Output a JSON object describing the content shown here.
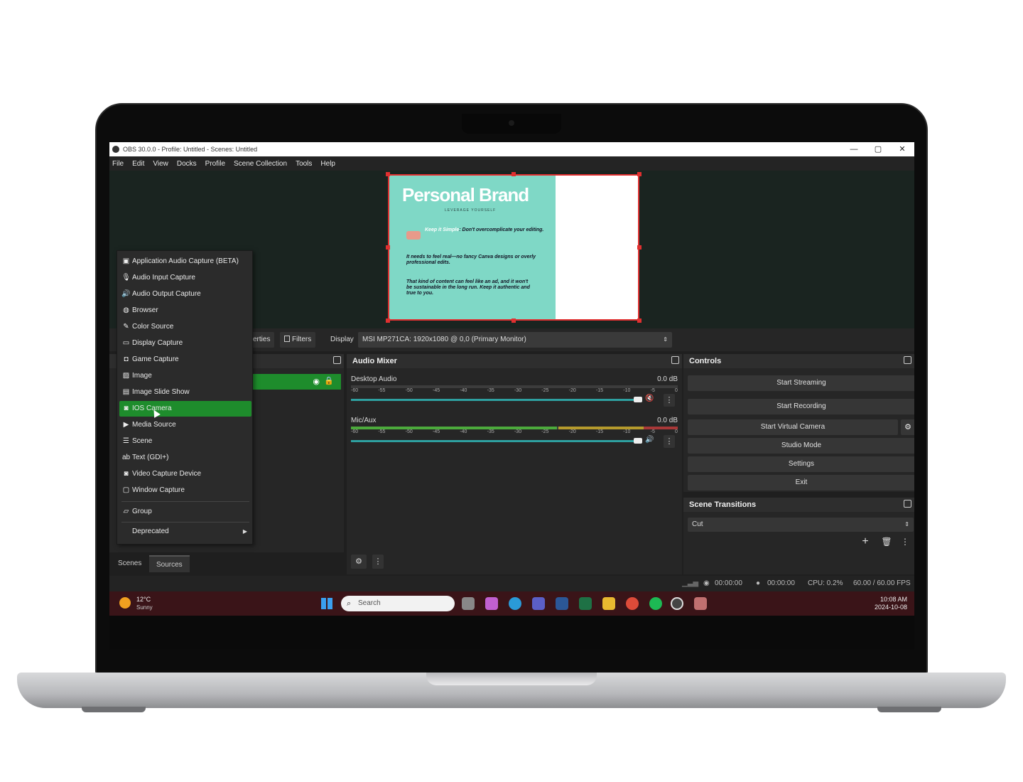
{
  "window": {
    "title": "OBS 30.0.0 - Profile: Untitled - Scenes: Untitled",
    "controls": [
      "—",
      "▢",
      "✕"
    ]
  },
  "menubar": [
    "File",
    "Edit",
    "View",
    "Docks",
    "Profile",
    "Scene Collection",
    "Tools",
    "Help"
  ],
  "preview": {
    "slide_title": "Personal Brand",
    "slide_subtitle": "LEVERAGE YOURSELF",
    "highlight": "Keep it Simple",
    "line1": ": Don't overcomplicate your editing.",
    "line2": "It needs to feel real—no fancy Canva designs or overly professional edits.",
    "line3": "That kind of content can feel like an ad, and it won't be sustainable in the long run. Keep it authentic and true to you."
  },
  "source_toolbar": {
    "properties": "erties",
    "filters": "Filters",
    "display_label": "Display",
    "display_value": "MSI MP271CA: 1920x1080 @ 0,0 (Primary Monitor)"
  },
  "audio_mixer": {
    "title": "Audio Mixer",
    "ticks": [
      "-60",
      "-55",
      "-50",
      "-45",
      "-40",
      "-35",
      "-30",
      "-25",
      "-20",
      "-15",
      "-10",
      "-5",
      "0"
    ],
    "channels": [
      {
        "name": "Desktop Audio",
        "db": "0.0 dB",
        "muted": true
      },
      {
        "name": "Mic/Aux",
        "db": "0.0 dB",
        "muted": false
      }
    ]
  },
  "controls": {
    "title": "Controls",
    "buttons": [
      "Start Streaming",
      "Start Recording",
      "Start Virtual Camera",
      "Studio Mode",
      "Settings",
      "Exit"
    ]
  },
  "scene_transitions": {
    "title": "Scene Transitions",
    "selected": "Cut"
  },
  "dock_tabs": [
    "Scenes",
    "Sources"
  ],
  "context_menu": {
    "items": [
      {
        "icon": "app-audio-icon",
        "label": "Application Audio Capture (BETA)"
      },
      {
        "icon": "microphone-icon",
        "label": "Audio Input Capture"
      },
      {
        "icon": "speaker-icon",
        "label": "Audio Output Capture"
      },
      {
        "icon": "globe-icon",
        "label": "Browser"
      },
      {
        "icon": "brush-icon",
        "label": "Color Source"
      },
      {
        "icon": "monitor-icon",
        "label": "Display Capture"
      },
      {
        "icon": "gamepad-icon",
        "label": "Game Capture"
      },
      {
        "icon": "image-icon",
        "label": "Image"
      },
      {
        "icon": "slideshow-icon",
        "label": "Image Slide Show"
      },
      {
        "icon": "camera-icon",
        "label": "IOS Camera"
      },
      {
        "icon": "play-icon",
        "label": "Media Source"
      },
      {
        "icon": "list-icon",
        "label": "Scene"
      },
      {
        "icon": "text-icon",
        "label": "Text (GDI+)"
      },
      {
        "icon": "camera-icon",
        "label": "Video Capture Device"
      },
      {
        "icon": "window-icon",
        "label": "Window Capture"
      }
    ],
    "group": "Group",
    "deprecated": "Deprecated",
    "active_index": 9
  },
  "status": {
    "rec_time": "00:00:00",
    "stream_time": "00:00:00",
    "cpu": "CPU: 0.2%",
    "fps": "60.00 / 60.00 FPS"
  },
  "taskbar": {
    "temp": "12°C",
    "condition": "Sunny",
    "search_placeholder": "Search",
    "time": "10:08 AM",
    "date": "2024-10-08"
  }
}
